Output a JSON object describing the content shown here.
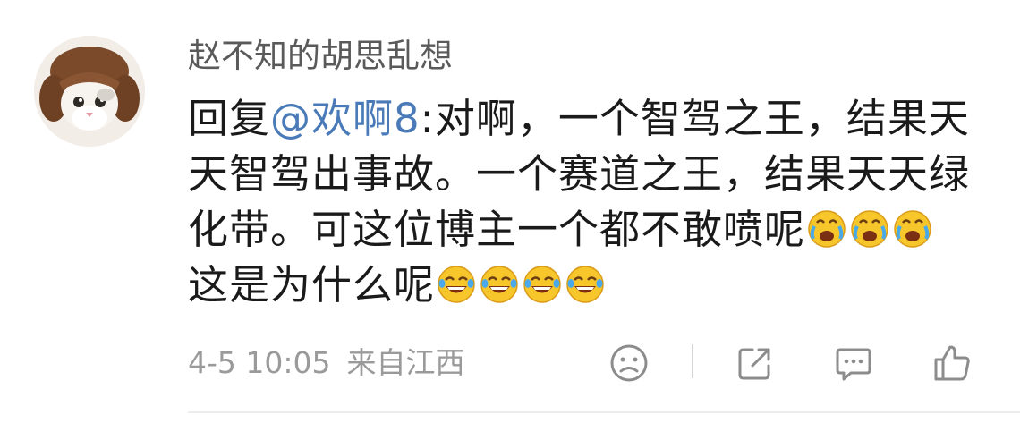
{
  "comment": {
    "username": "赵不知的胡思乱想",
    "reply_prefix": "回复",
    "mention": "@欢啊8",
    "text_part1": ":对啊，一个智驾之王，结果天天智驾出事故。一个赛道之王，结果天天绿化带。可这位博主一个都不敢喷呢",
    "text_part2": "这是为什么呢",
    "emoji_cry_1": "crying-emoji",
    "emoji_laugh": "laugh-tears-emoji",
    "timestamp": "4-5 10:05",
    "location": "来自江西"
  },
  "actions": {
    "dislike_icon": "sad-face-icon",
    "share_icon": "share-icon",
    "comment_icon": "comment-icon",
    "like_icon": "thumbs-up-icon"
  },
  "colors": {
    "mention": "#4a7bb8",
    "text": "#1a1a1a",
    "username": "#5a5a5a",
    "meta": "#9a9a9a",
    "icon": "#8c8c8c"
  }
}
